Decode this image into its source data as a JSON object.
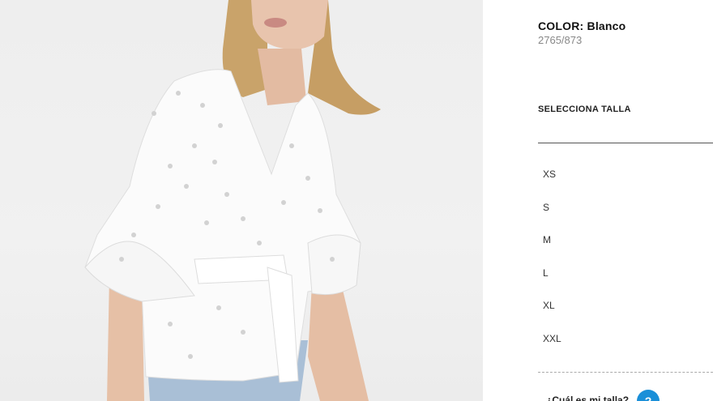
{
  "product": {
    "color_label": "COLOR:",
    "color_value": "Blanco",
    "reference": "2765/873"
  },
  "size_selector": {
    "title": "SELECCIONA TALLA",
    "sizes": [
      "XS",
      "S",
      "M",
      "L",
      "XL",
      "XXL"
    ]
  },
  "size_help": {
    "text": "¿Cuál es mi talla?",
    "icon_glyph": "?"
  },
  "colors": {
    "help_icon": "#1a8fd8",
    "background": "#ffffff",
    "photo_background": "#efefef"
  }
}
